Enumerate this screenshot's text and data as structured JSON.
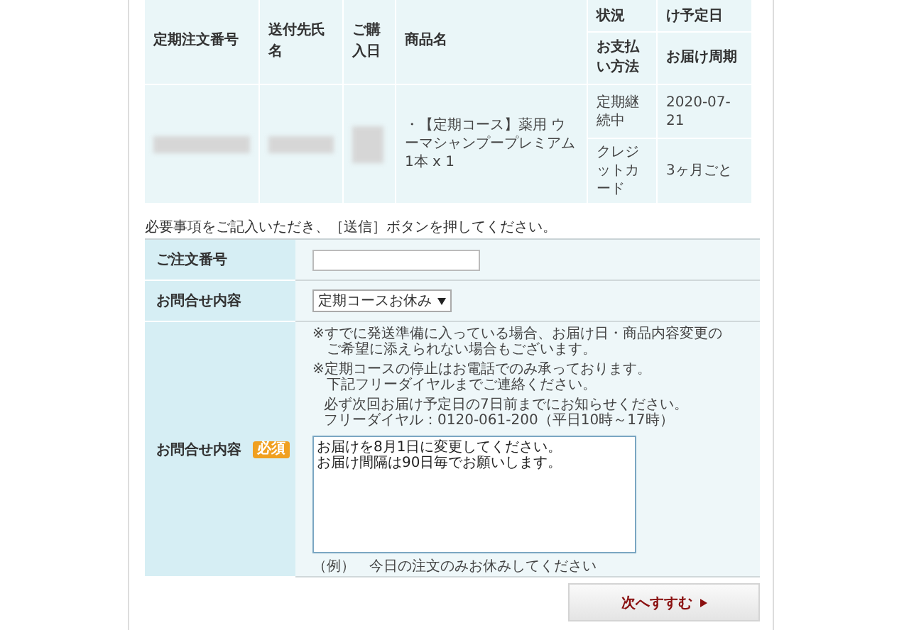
{
  "order_table": {
    "headers": [
      {
        "label": "定期注文番号"
      },
      {
        "label": "送付先氏名"
      },
      {
        "label": "ご購入日"
      },
      {
        "label": "商品名"
      }
    ],
    "status_header": "状況",
    "next_delivery_header": "け予定日",
    "payment_header": "お支払い方法",
    "cycle_header": "お届け周期",
    "rows": [
      {
        "order_number_redacted": true,
        "recipient_redacted": true,
        "purchase_date_redacted": true,
        "product": "・【定期コース】薬用 ウーマシャンプープレミアム1本 x 1",
        "status": "定期継続中",
        "next_delivery": "2020-07-21",
        "payment": "クレジットカード",
        "cycle": "3ヶ月ごと"
      }
    ]
  },
  "instruction": "必要事項をご記入いただき、［送信］ボタンを押してください。",
  "form": [
    {
      "kind": "text",
      "label": "ご注文番号"
    },
    {
      "kind": "select",
      "label": "お問合せ内容",
      "value": "定期コースお休み"
    },
    {
      "kind": "textarea",
      "label": "お問合せ内容",
      "badge": "必須",
      "notes": [
        {
          "lines": [
            "※すでに発送準備に入っている場合、お届け日・商品内容変更の",
            "ご希望に添えられない場合もございます。"
          ],
          "hanging": true
        },
        {
          "lines": [
            "※定期コースの停止はお電話でのみ承っております。",
            "下記フリーダイヤルまでご連絡ください。"
          ],
          "hanging": true
        },
        {
          "lines": [
            "必ず次回お届け予定日の7日前までにお知らせください。",
            "フリーダイヤル：0120-061-200（平日10時～17時）"
          ],
          "hanging": false
        }
      ],
      "value_lines": [
        "お届けを8月1日に変更してください。",
        "お届け間隔は90日毎でお願いします。"
      ],
      "example": "（例）　今日の注文のみお休みしてください"
    }
  ],
  "submit_button": "次へすすむ"
}
